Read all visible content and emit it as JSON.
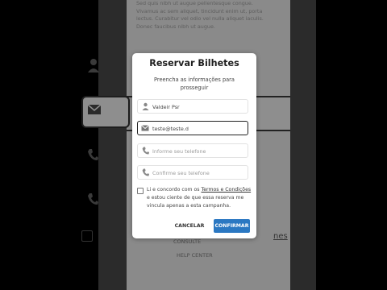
{
  "background": {
    "paragraph": "Sed quis nibh ut augue pellentesque congue. Vivamus ac sem aliquet, tincidunt enim ut, porta lectus. Curabitur vel odio vel nulla aliquet iaculis. Donec faucibus nibh ut augue.",
    "label_below_a": "CONSULTE",
    "label_below_b": "HELP CENTER",
    "label_right": "nes"
  },
  "modal": {
    "title": "Reservar Bilhetes",
    "subtitle": "Preencha as informações para prosseguir",
    "fields": {
      "name": {
        "value": "Valdeir Psr",
        "icon": "user-icon"
      },
      "email": {
        "value": "teste@teste.d",
        "icon": "envelope-icon"
      },
      "phone": {
        "placeholder": "Informe seu telefone",
        "icon": "phone-icon"
      },
      "phone_confirm": {
        "placeholder": "Confirme seu telefone",
        "icon": "phone-icon"
      }
    },
    "consent": {
      "before": "Li e concordo com os ",
      "link": "Termos e Condições",
      "after": " e estou ciente de que essa reserva me vincula apenas a esta campanha."
    },
    "buttons": {
      "cancel": "CANCELAR",
      "confirm": "CONFIRMAR"
    }
  },
  "colors": {
    "primary": "#2b78c2",
    "overlay": "#8a8a8a"
  }
}
